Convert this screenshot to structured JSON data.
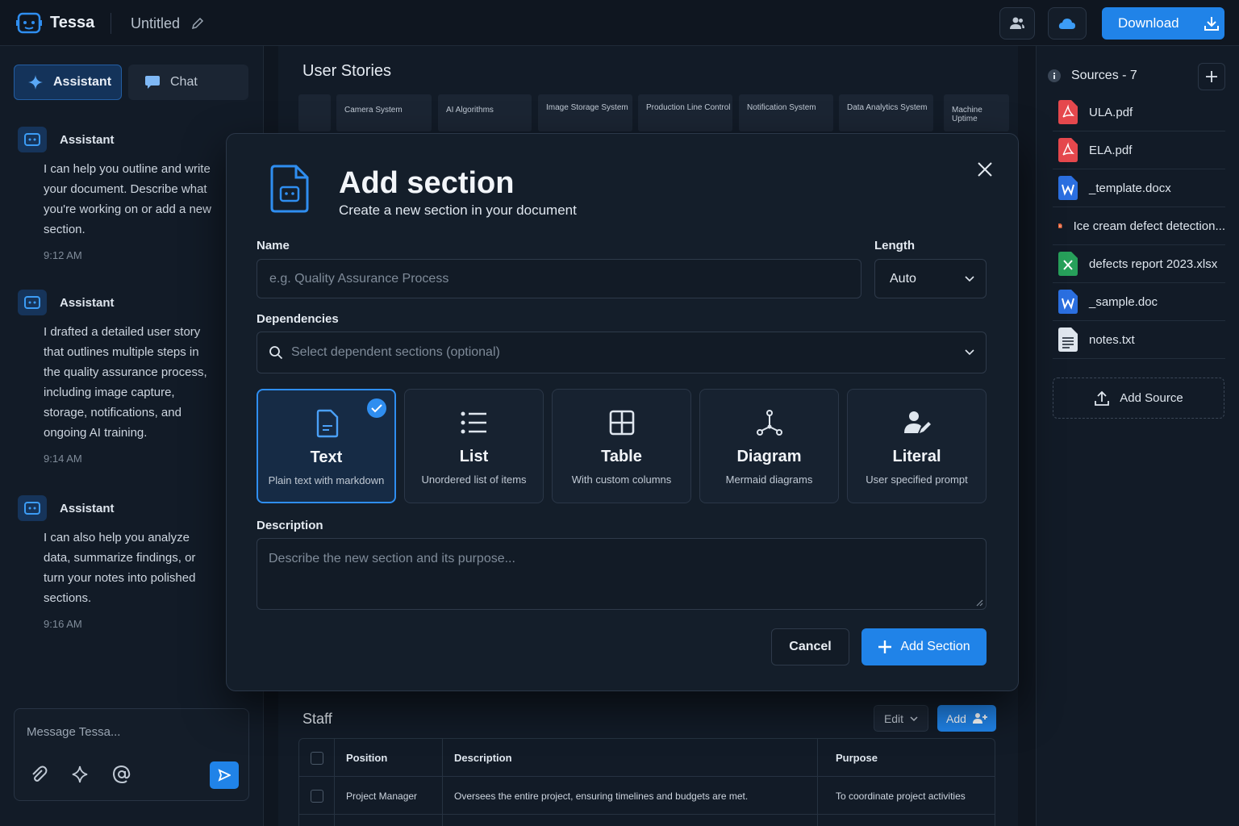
{
  "app": {
    "name": "Tessa",
    "doc_title": "Untitled",
    "download_label": "Download"
  },
  "left": {
    "tabs": [
      {
        "label": "Assistant"
      },
      {
        "label": "Chat"
      }
    ],
    "messages": [
      {
        "author": "Assistant",
        "text": "I can help you outline and write your document. Describe what you're working on or add a new section.",
        "time": "9:12 AM"
      },
      {
        "author": "Assistant",
        "text": "I drafted a detailed user story that outlines multiple steps in the quality assurance process, including image capture, storage, notifications, and ongoing AI training.",
        "time": "9:14 AM"
      },
      {
        "author": "Assistant",
        "text": "I can also help you analyze data, summarize findings, or turn your notes into polished sections.",
        "time": "9:16 AM"
      }
    ],
    "composer_placeholder": "Message Tessa..."
  },
  "center": {
    "user_stories_title": "User Stories",
    "story_cards": [
      "Camera System",
      "AI Algorithms",
      "Image Storage System",
      "Production Line Control",
      "Notification System",
      "Data Analytics System",
      "Machine Uptime"
    ],
    "staff_title": "Staff",
    "edit_label": "Edit",
    "add_label": "Add",
    "table": {
      "headers": [
        "Position",
        "Description",
        "Purpose"
      ],
      "rows": [
        [
          "Project Manager",
          "Oversees the entire project, ensuring timelines and budgets are met.",
          "To coordinate project activities"
        ]
      ]
    }
  },
  "modal": {
    "title": "Add section",
    "subtitle": "Create a new section in your document",
    "name_label": "Name",
    "name_placeholder": "e.g. Quality Assurance Process",
    "length_label": "Length",
    "length_value": "Auto",
    "deps_label": "Dependencies",
    "deps_placeholder": "Select dependent sections (optional)",
    "types": [
      {
        "name": "Text",
        "desc": "Plain text with markdown",
        "icon": "document-icon",
        "selected": true
      },
      {
        "name": "List",
        "desc": "Unordered list of items",
        "icon": "list-icon",
        "selected": false
      },
      {
        "name": "Table",
        "desc": "With custom columns",
        "icon": "table-icon",
        "selected": false
      },
      {
        "name": "Diagram",
        "desc": "Mermaid diagrams",
        "icon": "diagram-icon",
        "selected": false
      },
      {
        "name": "Literal",
        "desc": "User specified prompt",
        "icon": "user-edit-icon",
        "selected": false
      }
    ],
    "desc_label": "Description",
    "desc_placeholder": "Describe the new section and its purpose...",
    "cancel_label": "Cancel",
    "submit_label": "Add Section"
  },
  "sources": {
    "title": "Sources - 7",
    "items": [
      {
        "name": "ULA.pdf",
        "type": "pdf"
      },
      {
        "name": "ELA.pdf",
        "type": "pdf"
      },
      {
        "name": "_template.docx",
        "type": "word"
      },
      {
        "name": "Ice cream defect detection...",
        "type": "ppt"
      },
      {
        "name": "defects report 2023.xlsx",
        "type": "excel"
      },
      {
        "name": "_sample.doc",
        "type": "word"
      },
      {
        "name": "notes.txt",
        "type": "text"
      }
    ],
    "add_label": "Add Source"
  },
  "colors": {
    "accent": "#2083e8",
    "bg": "#0f1620",
    "panel": "#121b27",
    "modal": "#141e2a",
    "pdf": "#e5484d",
    "word": "#2b6fe0",
    "ppt": "#e8643a",
    "excel": "#27a05a"
  }
}
